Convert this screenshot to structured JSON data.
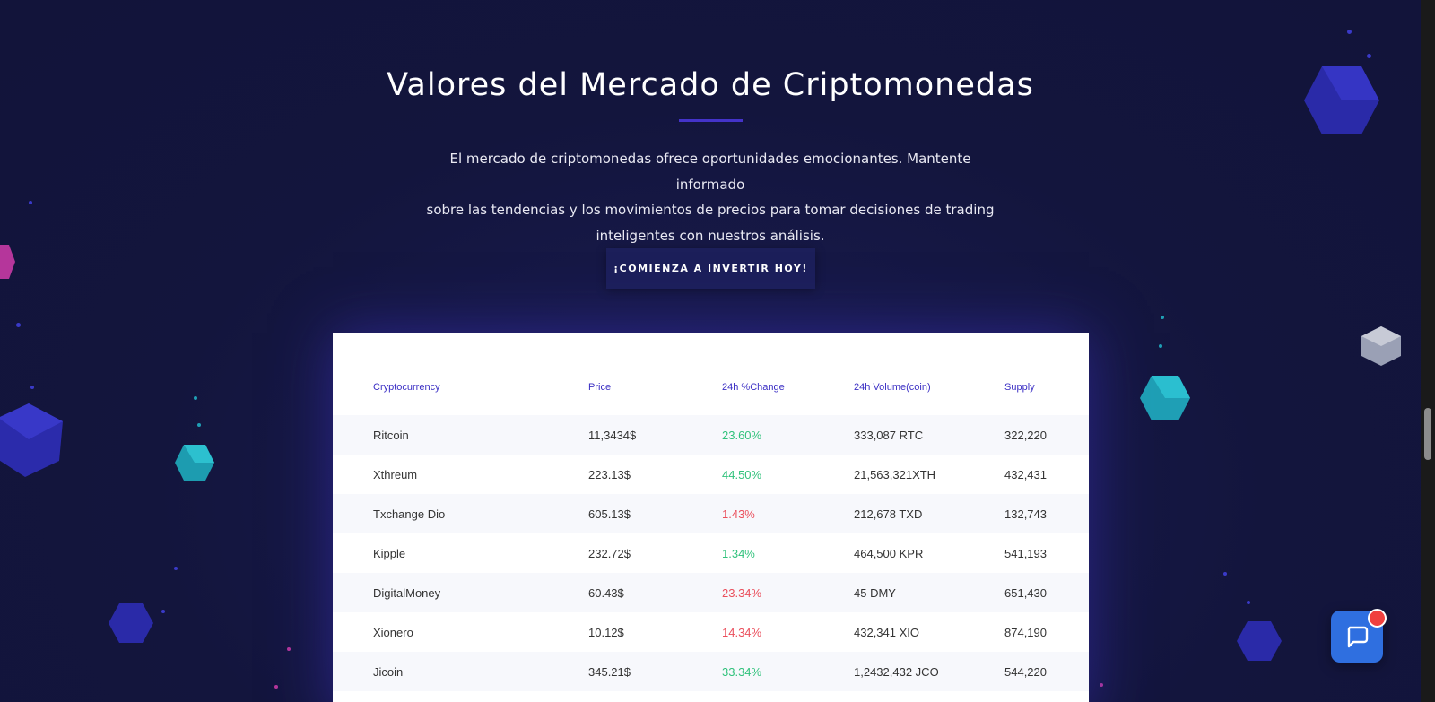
{
  "section": {
    "title": "Valores del Mercado de Criptomonedas",
    "description_lines": [
      "El mercado de criptomonedas ofrece oportunidades emocionantes. Mantente informado",
      "sobre las tendencias y los movimientos de precios para tomar decisiones de trading",
      "inteligentes con nuestros análisis."
    ],
    "cta_label": "¡COMIENZA A INVERTIR HOY!"
  },
  "table": {
    "headers": [
      "Cryptocurrency",
      "Price",
      "24h %Change",
      "24h Volume(coin)",
      "Supply"
    ],
    "rows": [
      {
        "name": "Ritcoin",
        "price": "11,3434$",
        "change": "23.60%",
        "trend": "up",
        "volume": "333,087 RTC",
        "supply": "322,220"
      },
      {
        "name": "Xthreum",
        "price": "223.13$",
        "change": "44.50%",
        "trend": "up",
        "volume": "21,563,321XTH",
        "supply": "432,431"
      },
      {
        "name": "Txchange Dio",
        "price": "605.13$",
        "change": "1.43%",
        "trend": "down",
        "volume": "212,678 TXD",
        "supply": "132,743"
      },
      {
        "name": "Kipple",
        "price": "232.72$",
        "change": "1.34%",
        "trend": "up",
        "volume": "464,500 KPR",
        "supply": "541,193"
      },
      {
        "name": "DigitalMoney",
        "price": "60.43$",
        "change": "23.34%",
        "trend": "down",
        "volume": "45 DMY",
        "supply": "651,430"
      },
      {
        "name": "Xionero",
        "price": "10.12$",
        "change": "14.34%",
        "trend": "down",
        "volume": "432,341 XIO",
        "supply": "874,190"
      },
      {
        "name": "Jicoin",
        "price": "345.21$",
        "change": "33.34%",
        "trend": "up",
        "volume": "1,2432,432 JCO",
        "supply": "544,220"
      }
    ]
  },
  "colors": {
    "background": "#12143a",
    "accent": "#4433c9",
    "header_text": "#3b2fc4",
    "positive": "#31c27c",
    "negative": "#ea4f5c",
    "chat_button": "#2f6fe0"
  },
  "icons": {
    "chat": "chat-bubble-icon"
  }
}
